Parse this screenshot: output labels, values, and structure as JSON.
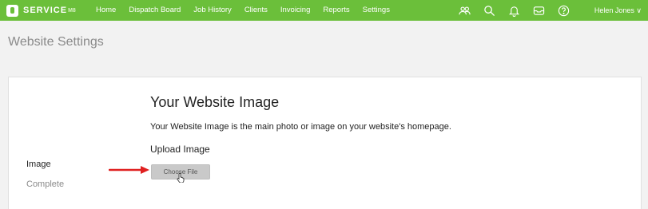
{
  "app": {
    "logo_text": "SERVICE",
    "logo_sup": "M8",
    "colors": {
      "brand": "#6bbf3a",
      "arrow": "#e02020"
    }
  },
  "nav": {
    "items": [
      {
        "label": "Home"
      },
      {
        "label": "Dispatch Board"
      },
      {
        "label": "Job History"
      },
      {
        "label": "Clients"
      },
      {
        "label": "Invoicing"
      },
      {
        "label": "Reports"
      },
      {
        "label": "Settings"
      }
    ],
    "icons": [
      "people-icon",
      "search-icon",
      "bell-icon",
      "inbox-icon",
      "help-icon"
    ],
    "user": "Helen Jones ∨"
  },
  "page": {
    "title": "Website Settings"
  },
  "section": {
    "side_label": "Image",
    "side_status": "Complete",
    "heading": "Your Website Image",
    "description": "Your Website Image is the main photo or image on your website's homepage.",
    "upload_label": "Upload Image",
    "choose_file": "Choose File"
  }
}
